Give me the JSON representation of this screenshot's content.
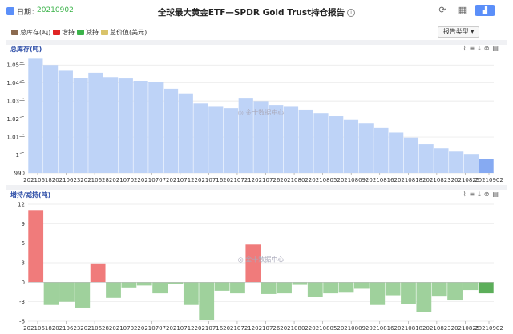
{
  "header": {
    "date_label": "日期：",
    "date_value": "20210902",
    "title": "全球最大黄金ETF—SPDR Gold Trust持仓报告",
    "info_icon": "info-icon",
    "refresh_icon": "refresh-icon",
    "grid_icon": "grid-icon",
    "chart_icon": "chart-icon"
  },
  "legend": {
    "items": [
      {
        "label": "总库存(吨)",
        "color": "#8b6a4f"
      },
      {
        "label": "增持",
        "color": "#e02424"
      },
      {
        "label": "减持",
        "color": "#3bb34a"
      },
      {
        "label": "总价值(美元)",
        "color": "#d9c36a"
      }
    ]
  },
  "report_type": "报告类型",
  "watermark": "金十数据中心",
  "colors": {
    "inventory_bar": "#bed3f7",
    "inventory_last": "#86aaf2",
    "increase": "#f07b7b",
    "decrease": "#9fd19c",
    "decrease_last": "#5cae5a",
    "accent": "#5b8ff9"
  },
  "chart_data": [
    {
      "type": "bar",
      "title": "总库存(吨)",
      "ylim": [
        990,
        1055
      ],
      "y_ticks": [
        "1.05千",
        "1.04千",
        "1.03千",
        "1.02千",
        "1.01千",
        "1千",
        "990"
      ],
      "tick_values": [
        1050,
        1040,
        1030,
        1020,
        1010,
        1000,
        990
      ],
      "x_tick_labels": [
        "20210618",
        "20210623",
        "20210628",
        "20210702",
        "20210707",
        "20210712",
        "20210716",
        "20210721",
        "20210726",
        "20210802",
        "20210805",
        "20210809",
        "20210816",
        "20210818",
        "20210823",
        "20210825",
        "20210902"
      ],
      "values": [
        1053.5,
        1050.0,
        1046.8,
        1042.8,
        1045.7,
        1043.3,
        1042.5,
        1041.2,
        1040.7,
        1036.8,
        1034.2,
        1028.6,
        1027.2,
        1026.0,
        1031.8,
        1029.9,
        1027.8,
        1027.2,
        1025.2,
        1023.3,
        1021.6,
        1019.5,
        1017.5,
        1015.0,
        1012.5,
        1009.7,
        1006.0,
        1003.7,
        1001.9,
        1000.6,
        998.0
      ],
      "grid": true
    },
    {
      "type": "bar",
      "title": "增持/减持(吨)",
      "ylim": [
        -6,
        12
      ],
      "y_ticks": [
        "12",
        "9",
        "6",
        "3",
        "0",
        "-3",
        "-6"
      ],
      "tick_values": [
        12,
        9,
        6,
        3,
        0,
        -3,
        -6
      ],
      "x_tick_labels": [
        "20210618",
        "20210623",
        "20210628",
        "20210702",
        "20210707",
        "20210712",
        "20210716",
        "20210721",
        "20210726",
        "20210802",
        "20210805",
        "20210809",
        "20210816",
        "20210818",
        "20210823",
        "20210825",
        "20210902"
      ],
      "values": [
        11.1,
        -3.5,
        -3.0,
        -3.9,
        2.9,
        -2.4,
        -0.8,
        -0.5,
        -1.7,
        -0.3,
        -3.5,
        -5.8,
        -1.3,
        -1.7,
        5.8,
        -1.8,
        -1.7,
        -0.4,
        -2.3,
        -1.7,
        -1.6,
        -1.0,
        -3.5,
        -2.0,
        -3.4,
        -4.6,
        -2.2,
        -2.8,
        -1.2,
        -1.7
      ],
      "grid": true
    }
  ]
}
